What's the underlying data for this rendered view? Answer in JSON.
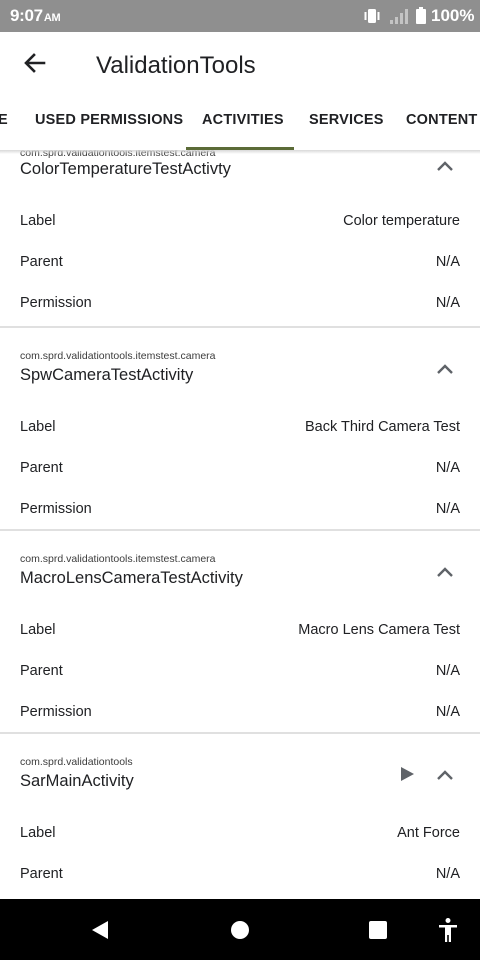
{
  "status_bar": {
    "time": "9:07",
    "ampm": "AM",
    "battery_percent": "100%",
    "icons": [
      "vibrate-icon",
      "signal-icon",
      "battery-icon"
    ]
  },
  "app_bar": {
    "title": "ValidationTools",
    "back_icon": "arrow-back-icon"
  },
  "tabs": [
    {
      "label": "E"
    },
    {
      "label": "USED PERMISSIONS"
    },
    {
      "label": "ACTIVITIES",
      "selected": true
    },
    {
      "label": "SERVICES"
    },
    {
      "label": "CONTENT P"
    }
  ],
  "field_labels": {
    "label": "Label",
    "parent": "Parent",
    "permission": "Permission"
  },
  "activities": [
    {
      "package": "com.sprd.validationtools.itemstest.camera",
      "name": "ColorTemperatureTestActivty",
      "label": "Color temperature",
      "parent": "N/A",
      "permission": "N/A"
    },
    {
      "package": "com.sprd.validationtools.itemstest.camera",
      "name": "SpwCameraTestActivity",
      "label": "Back Third Camera Test",
      "parent": "N/A",
      "permission": "N/A"
    },
    {
      "package": "com.sprd.validationtools.itemstest.camera",
      "name": "MacroLensCameraTestActivity",
      "label": "Macro Lens Camera Test",
      "parent": "N/A",
      "permission": "N/A"
    },
    {
      "package": "com.sprd.validationtools",
      "name": "SarMainActivity",
      "label": "Ant Force",
      "parent": "N/A",
      "launchable": true
    }
  ],
  "nav_bar": {
    "icons": [
      "nav-back-icon",
      "nav-home-icon",
      "nav-recents-icon",
      "accessibility-icon"
    ]
  },
  "colors": {
    "status_bar_bg": "#8f8f8f",
    "tab_indicator": "#5b6b37",
    "nav_bar_bg": "#000000",
    "icon_gray": "#5f6368"
  }
}
